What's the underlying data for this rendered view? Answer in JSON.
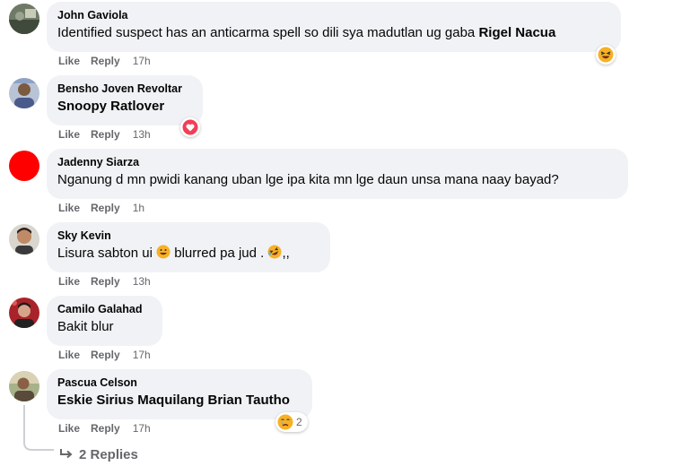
{
  "comments": [
    {
      "author": "John Gaviola",
      "text_plain": "Identified suspect has an anticarma spell so dili sya madutlan ug gaba ",
      "text_bold": "Rigel Nacua",
      "like": "Like",
      "reply": "Reply",
      "time": "17h",
      "reaction": "laughing-emoji"
    },
    {
      "author": "Bensho Joven Revoltar",
      "text_bold": "Snoopy Ratlover",
      "like": "Like",
      "reply": "Reply",
      "time": "13h",
      "reaction": "heart"
    },
    {
      "author": "Jadenny Siarza",
      "text_plain": "Nganung d mn pwidi kanang uban lge ipa kita mn lge daun unsa mana naay bayad?",
      "like": "Like",
      "reply": "Reply",
      "time": "1h"
    },
    {
      "author": "Sky Kevin",
      "text_part1": "Lisura sabton ui ",
      "text_part2": " blurred pa jud . ",
      "text_part3": ",,",
      "like": "Like",
      "reply": "Reply",
      "time": "13h"
    },
    {
      "author": "Camilo Galahad",
      "text_plain": "Bakit blur",
      "like": "Like",
      "reply": "Reply",
      "time": "17h"
    },
    {
      "author": "Pascua Celson",
      "text_bold": "Eskie Sirius Maquilang Brian Tautho",
      "like": "Like",
      "reply": "Reply",
      "time": "17h",
      "reaction": "crying-emoji",
      "reaction_count": "2"
    }
  ],
  "replies_label": "2 Replies",
  "colors": {
    "bubble": "#f0f2f5",
    "meta": "#65676b",
    "heart": "#f33e58",
    "emoji": "#f7b125",
    "avatar_red": "#ff0000"
  }
}
